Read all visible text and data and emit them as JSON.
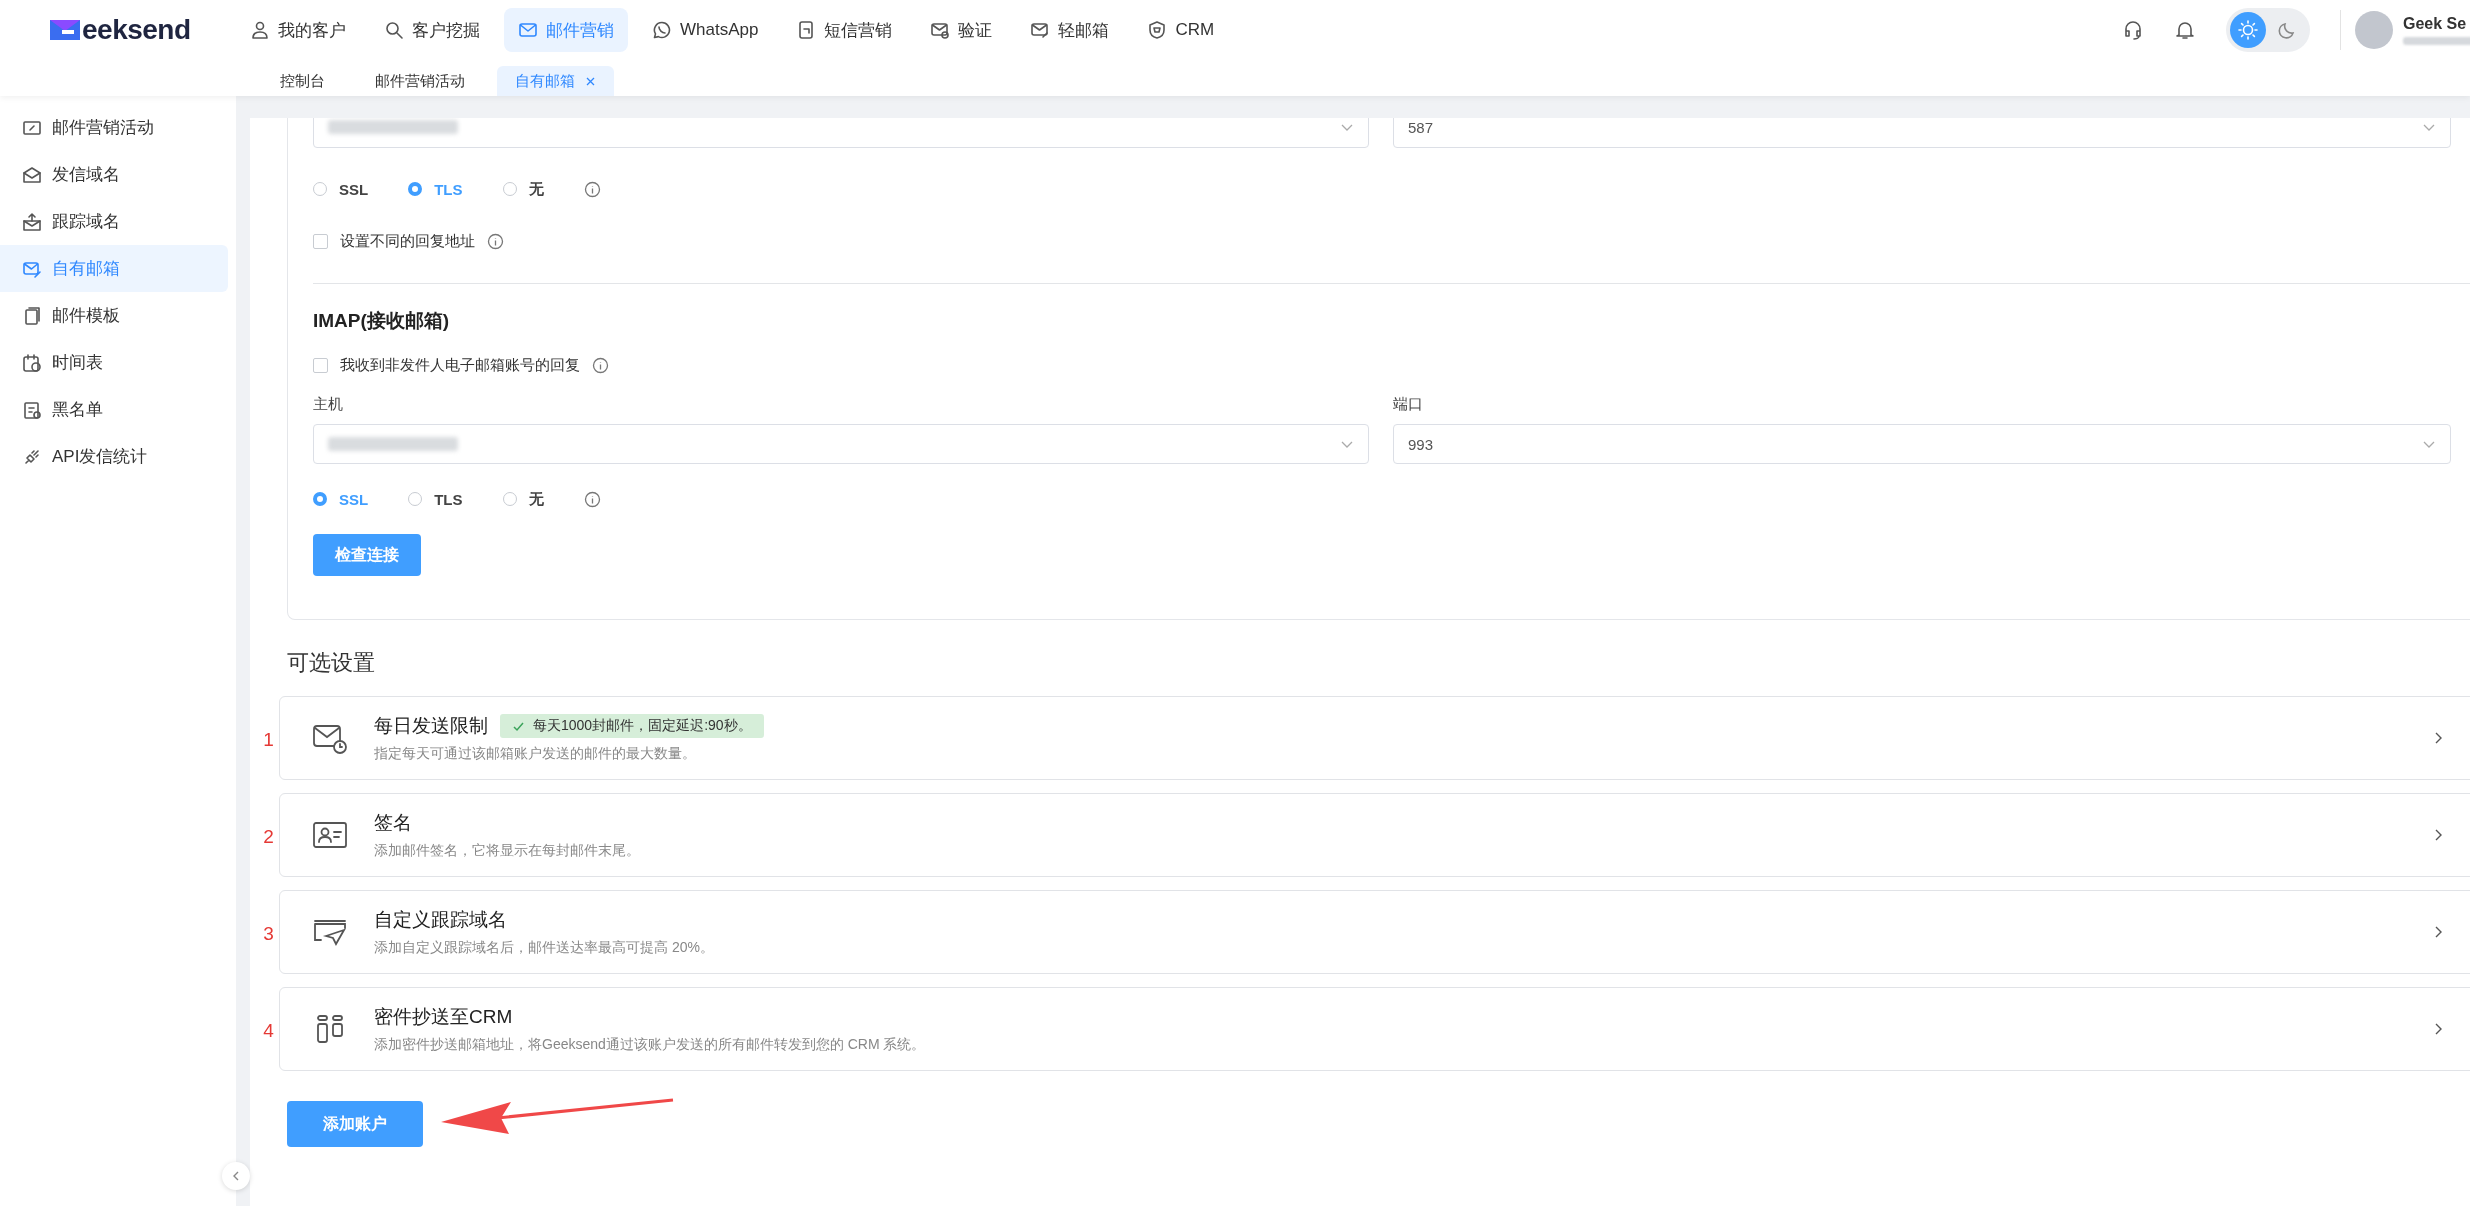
{
  "logo": {
    "text": "eeksend"
  },
  "nav": [
    {
      "label": "我的客户",
      "selected": false
    },
    {
      "label": "客户挖掘",
      "selected": false
    },
    {
      "label": "邮件营销",
      "selected": true
    },
    {
      "label": "WhatsApp",
      "selected": false
    },
    {
      "label": "短信营销",
      "selected": false
    },
    {
      "label": "验证",
      "selected": false
    },
    {
      "label": "轻邮箱",
      "selected": false
    },
    {
      "label": "CRM",
      "selected": false
    }
  ],
  "subtabs": [
    {
      "label": "控制台",
      "selected": false,
      "closable": false
    },
    {
      "label": "邮件营销活动",
      "selected": false,
      "closable": false
    },
    {
      "label": "自有邮箱",
      "selected": true,
      "closable": true
    }
  ],
  "theme_options": [
    {
      "selected": true
    },
    {
      "selected": false
    }
  ],
  "user": {
    "name": "Geek Se"
  },
  "sidebar": {
    "items": [
      {
        "label": "邮件营销活动",
        "selected": false
      },
      {
        "label": "发信域名",
        "selected": false
      },
      {
        "label": "跟踪域名",
        "selected": false
      },
      {
        "label": "自有邮箱",
        "selected": true
      },
      {
        "label": "邮件模板",
        "selected": false
      },
      {
        "label": "时间表",
        "selected": false
      },
      {
        "label": "黑名单",
        "selected": false
      },
      {
        "label": "API发信统计",
        "selected": false
      }
    ]
  },
  "smtp": {
    "port": "587",
    "security": [
      {
        "label": "SSL",
        "selected": false
      },
      {
        "label": "TLS",
        "selected": true
      },
      {
        "label": "无",
        "selected": false
      }
    ],
    "reply_checkbox": {
      "label": "设置不同的回复地址",
      "checked": false
    }
  },
  "imap": {
    "heading": "IMAP(接收邮箱)",
    "checkbox": {
      "label": "我收到非发件人电子邮箱账号的回复",
      "checked": false
    },
    "host_label": "主机",
    "port_label": "端口",
    "port": "993",
    "security": [
      {
        "label": "SSL",
        "selected": true
      },
      {
        "label": "TLS",
        "selected": false
      },
      {
        "label": "无",
        "selected": false
      }
    ],
    "button": "检查连接"
  },
  "optional": {
    "heading": "可选设置",
    "cards": [
      {
        "number": "1",
        "title": "每日发送限制",
        "badge": "每天1000封邮件，固定延迟:90秒。",
        "description": "指定每天可通过该邮箱账户发送的邮件的最大数量。"
      },
      {
        "number": "2",
        "title": "签名",
        "description": "添加邮件签名，它将显示在每封邮件末尾。"
      },
      {
        "number": "3",
        "title": "自定义跟踪域名",
        "description": "添加自定义跟踪域名后，邮件送达率最高可提高 20%。"
      },
      {
        "number": "4",
        "title": "密件抄送至CRM",
        "description": "添加密件抄送邮箱地址，将Geeksend通过该账户发送的所有邮件转发到您的 CRM 系统。"
      }
    ]
  },
  "add_button": "添加账户"
}
